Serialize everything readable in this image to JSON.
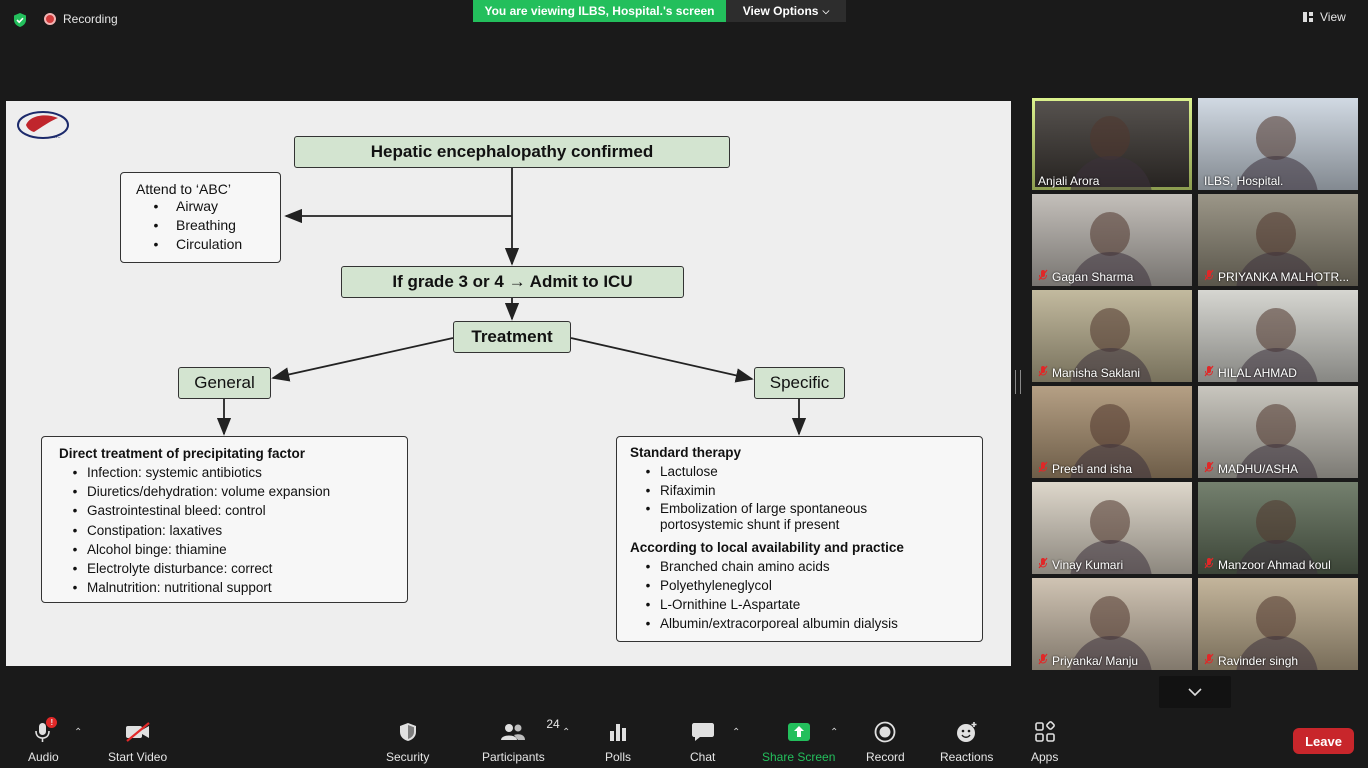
{
  "topbar": {
    "recording_label": "Recording",
    "viewing_banner": "You are viewing ILBS, Hospital.'s screen",
    "view_options": "View Options",
    "view_label": "View"
  },
  "slide": {
    "title": "Hepatic encephalopathy confirmed",
    "abc": {
      "heading": "Attend to ‘ABC’",
      "items": [
        "Airway",
        "Breathing",
        "Circulation"
      ]
    },
    "grade": "If grade 3 or 4 → Admit to ICU",
    "treatment": "Treatment",
    "general": "General",
    "specific": "Specific",
    "general_list": {
      "heading": "Direct treatment of precipitating factor",
      "items": [
        "Infection: systemic antibiotics",
        "Diuretics/dehydration: volume expansion",
        "Gastrointestinal bleed: control",
        "Constipation: laxatives",
        "Alcohol binge: thiamine",
        "Electrolyte disturbance: correct",
        "Malnutrition: nutritional support"
      ]
    },
    "specific_list": {
      "heading1": "Standard therapy",
      "items1": [
        "Lactulose",
        "Rifaximin",
        "Embolization of large spontaneous portosystemic shunt if present"
      ],
      "heading2": "According to local availability and practice",
      "items2": [
        "Branched chain amino acids",
        "Polyethyleneglycol",
        "L-Ornithine L-Aspartate",
        "Albumin/extracorporeal albumin dialysis"
      ]
    }
  },
  "participants": [
    {
      "name": "Anjali Arora",
      "muted": false,
      "active": true,
      "bg": "#3a3531"
    },
    {
      "name": "ILBS, Hospital.",
      "muted": false,
      "active": false,
      "bg": "#c9d3de"
    },
    {
      "name": "Gagan Sharma",
      "muted": true,
      "active": false,
      "bg": "#b9b4ae"
    },
    {
      "name": "PRIYANKA MALHOTR...",
      "muted": true,
      "active": false,
      "bg": "#8a8473"
    },
    {
      "name": "Manisha Saklani",
      "muted": true,
      "active": false,
      "bg": "#b8ae8e"
    },
    {
      "name": "HILAL AHMAD",
      "muted": true,
      "active": false,
      "bg": "#cfcfc9"
    },
    {
      "name": "Preeti and isha",
      "muted": true,
      "active": false,
      "bg": "#a88f6f"
    },
    {
      "name": "MADHU/ASHA",
      "muted": true,
      "active": false,
      "bg": "#bfbcb3"
    },
    {
      "name": "Vinay Kumari",
      "muted": true,
      "active": false,
      "bg": "#d8d0c2"
    },
    {
      "name": "Manzoor Ahmad koul",
      "muted": true,
      "active": false,
      "bg": "#5c6a55"
    },
    {
      "name": "Priyanka/ Manju",
      "muted": true,
      "active": false,
      "bg": "#c7b9a6"
    },
    {
      "name": "Ravinder singh",
      "muted": true,
      "active": false,
      "bg": "#b9a88a"
    }
  ],
  "toolbar": {
    "audio": "Audio",
    "start_video": "Start Video",
    "security": "Security",
    "participants": "Participants",
    "participants_count": "24",
    "polls": "Polls",
    "chat": "Chat",
    "share_screen": "Share Screen",
    "record": "Record",
    "reactions": "Reactions",
    "apps": "Apps",
    "leave": "Leave",
    "audio_badge": "!"
  },
  "colors": {
    "banner_green": "#23bf5c",
    "leave_red": "#c8262b",
    "active_speaker": "#d6f07a",
    "box_green": "#d3e4d0"
  }
}
